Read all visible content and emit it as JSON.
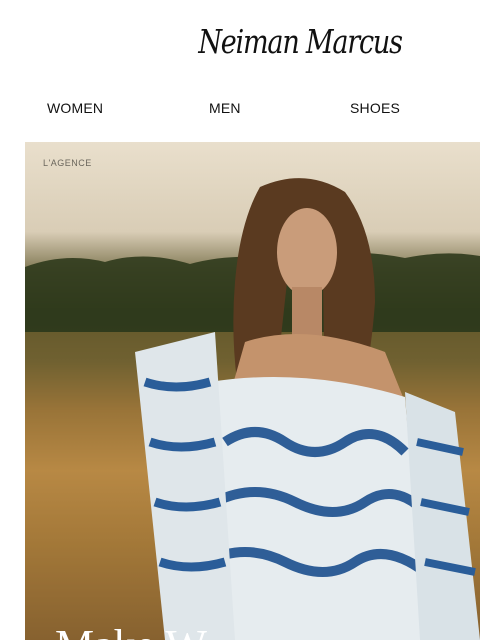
{
  "brand": {
    "logo_text": "Neiman Marcus"
  },
  "nav": {
    "items": [
      "WOMEN",
      "MEN",
      "SHOES"
    ]
  },
  "hero": {
    "brand_tag": "L'AGENCE",
    "headline": "Make W"
  }
}
